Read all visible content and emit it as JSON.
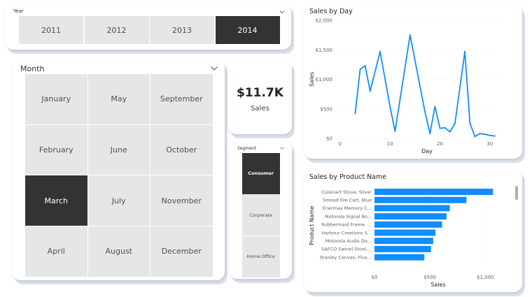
{
  "colors": {
    "accent": "#118DFF",
    "selected": "#333333",
    "tile": "#E6E6E6"
  },
  "year_slicer": {
    "header": "Year",
    "options": [
      "2011",
      "2012",
      "2013",
      "2014"
    ],
    "selected": "2014",
    "chevron_icon": "chevron-down-icon"
  },
  "month_slicer": {
    "header": "Month",
    "options": [
      "January",
      "May",
      "September",
      "February",
      "June",
      "October",
      "March",
      "July",
      "November",
      "April",
      "August",
      "December"
    ],
    "selected": "March",
    "chevron_icon": "chevron-down-icon"
  },
  "kpi_card": {
    "value": "$11.7K",
    "label": "Sales"
  },
  "segment_slicer": {
    "header": "Segment",
    "options": [
      "Consumer",
      "Corporate",
      "Home Office"
    ],
    "selected": "Consumer",
    "chevron_icon": "chevron-down-icon"
  },
  "chart_data": [
    {
      "type": "line",
      "title": "Sales by Day",
      "xlabel": "Day",
      "ylabel": "Sales",
      "x_ticks": [
        "0",
        "10",
        "20",
        "30"
      ],
      "y_ticks": [
        "$0",
        "$500",
        "$1,000",
        "$1,500",
        "$2,000"
      ],
      "xlim": [
        0,
        32
      ],
      "ylim": [
        0,
        2000
      ],
      "grid": true,
      "series": [
        {
          "x": [
            3,
            4,
            5,
            6,
            8,
            10,
            11,
            14,
            17,
            18,
            19,
            20,
            21,
            22,
            23,
            25,
            26,
            27,
            28,
            29,
            30,
            31
          ],
          "values": [
            420,
            1170,
            1230,
            800,
            1470,
            530,
            120,
            1750,
            450,
            80,
            540,
            170,
            180,
            110,
            250,
            1470,
            260,
            30,
            80,
            70,
            50,
            40
          ]
        }
      ]
    },
    {
      "type": "bar",
      "orientation": "horizontal",
      "title": "Sales by Product Name",
      "xlabel": "Sales",
      "ylabel": "Product Name",
      "x_ticks": [
        "$0",
        "$500",
        "$1,000"
      ],
      "xlim": [
        0,
        1150
      ],
      "grid": true,
      "categories": [
        "Cuisinart Stove, Silver",
        "Smead File Cart, Blue",
        "Enermax Memory C...",
        "Motorola Signal Bo...",
        "Rubbermaid Frame, ...",
        "Harbour Creations S...",
        "Motorola Audio Do...",
        "SAFCO Swivel Stool,...",
        "Stanley Canvas, Fluo..."
      ],
      "values": [
        1070,
        830,
        680,
        650,
        610,
        550,
        530,
        510,
        450
      ]
    }
  ]
}
